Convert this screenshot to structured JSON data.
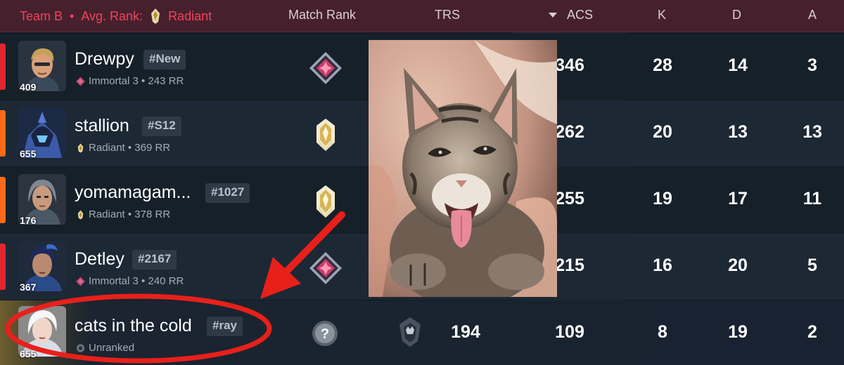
{
  "header": {
    "team": "Team B",
    "separator": "•",
    "avg_rank_label": "Avg. Rank:",
    "avg_rank_value": "Radiant",
    "col_match_rank": "Match Rank",
    "col_trs": "TRS",
    "col_acs": "ACS",
    "col_acs_sort_icon": "sort-desc-icon",
    "col_k": "K",
    "col_d": "D",
    "col_a": "A"
  },
  "colors": {
    "header_bg": "#47202d",
    "team_red": "#f0435b",
    "row_bar_red": "#e2252e",
    "row_bar_orange": "#ff6a1a",
    "arrow_red": "#e8201a"
  },
  "players": [
    {
      "level": "409",
      "name": "Drewpy",
      "tag": "#New",
      "rank": "Immortal 3 • 243 RR",
      "acs": "346",
      "k": "28",
      "d": "14",
      "a": "3",
      "match_rank_icon": "immortal-rank-icon"
    },
    {
      "level": "655",
      "name": "stallion",
      "tag": "#S12",
      "rank": "Radiant • 369 RR",
      "acs": "262",
      "k": "20",
      "d": "13",
      "a": "13",
      "match_rank_icon": "radiant-rank-icon"
    },
    {
      "level": "176",
      "name": "yomamagam...",
      "tag": "#1027",
      "rank": "Radiant • 378 RR",
      "acs": "255",
      "k": "19",
      "d": "17",
      "a": "11",
      "match_rank_icon": "radiant-rank-icon"
    },
    {
      "level": "367",
      "name": "Detley",
      "tag": "#2167",
      "rank": "Immortal 3 • 240 RR",
      "acs": "215",
      "k": "16",
      "d": "20",
      "a": "5",
      "match_rank_icon": "immortal-rank-icon"
    },
    {
      "level": "655",
      "name": "cats in the cold",
      "tag": "#ray",
      "rank": "Unranked",
      "trs": "194",
      "acs": "109",
      "k": "8",
      "d": "19",
      "a": "2",
      "match_rank_icon": "unranked-question-icon"
    }
  ]
}
